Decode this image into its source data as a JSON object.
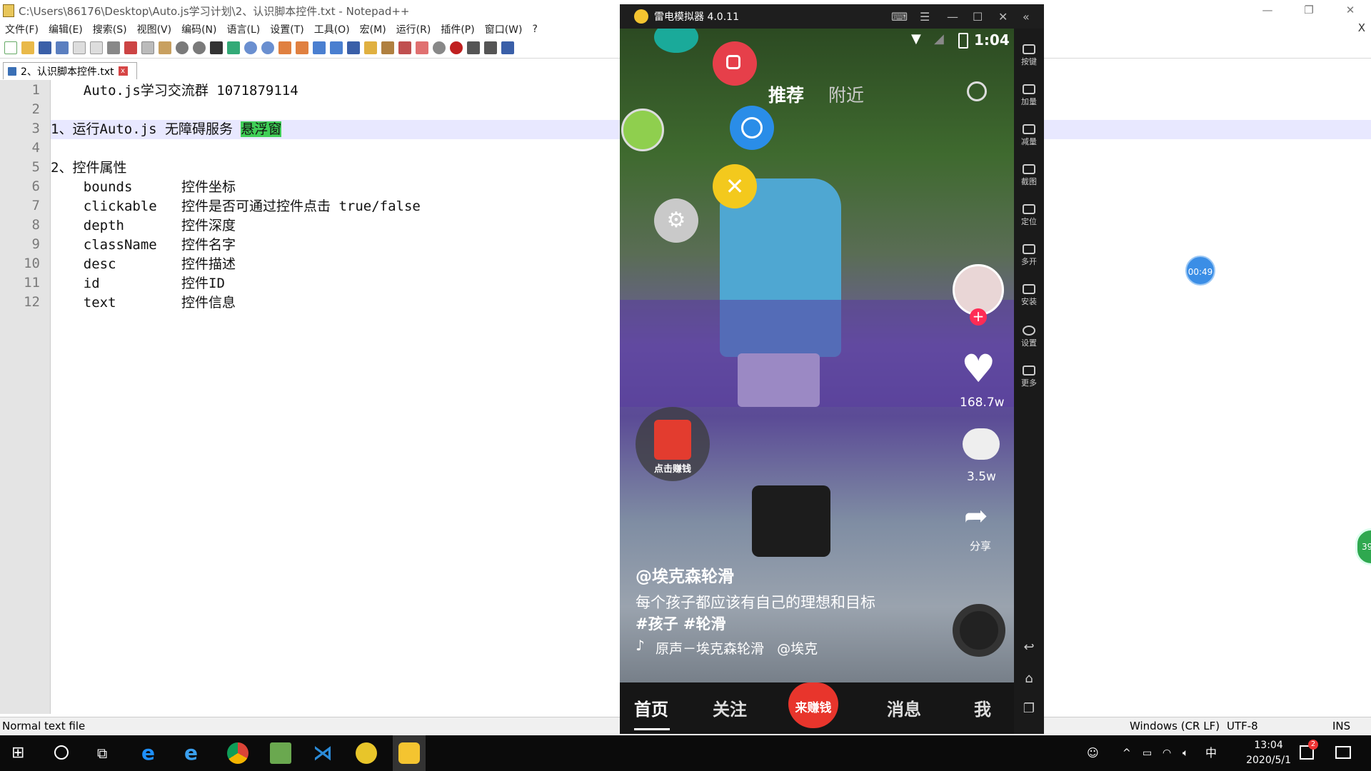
{
  "npp": {
    "title": "C:\\Users\\86176\\Desktop\\Auto.js学习计划\\2、认识脚本控件.txt - Notepad++",
    "menu": [
      "文件(F)",
      "编辑(E)",
      "搜索(S)",
      "视图(V)",
      "编码(N)",
      "语言(L)",
      "设置(T)",
      "工具(O)",
      "宏(M)",
      "运行(R)",
      "插件(P)",
      "窗口(W)",
      "?"
    ],
    "menu_close": "X",
    "tab_label": "2、认识脚本控件.txt",
    "tab_close": "x",
    "line_numbers": [
      "1",
      "2",
      "3",
      "4",
      "5",
      "6",
      "7",
      "8",
      "9",
      "10",
      "11",
      "12"
    ],
    "lines": {
      "l1": "    Auto.js学习交流群 1071879114",
      "l3a": "1、运行Auto.js 无障碍服务 ",
      "l3b": "悬浮窗",
      "l5": "2、控件属性",
      "l6": "    bounds      控件坐标",
      "l7": "    clickable   控件是否可通过控件点击 true/false",
      "l8": "    depth       控件深度",
      "l9": "    className   控件名字",
      "l10": "    desc        控件描述",
      "l11": "    id          控件ID",
      "l12": "    text        控件信息"
    },
    "status": {
      "file_type": "Normal text file",
      "eol": "Windows (CR LF)",
      "encoding": "UTF-8",
      "mode": "INS"
    }
  },
  "emulator": {
    "title": "雷电模拟器 4.0.11",
    "status_time": "1:04",
    "top_tabs": {
      "recommend": "推荐",
      "nearby": "附近"
    },
    "likes": "168.7w",
    "comments": "3.5w",
    "share": "分享",
    "earn_badge": "点击赚钱",
    "author": "@埃克森轮滑",
    "caption": "每个孩子都应该有自己的理想和目标",
    "tags": "#孩子 #轮滑",
    "music": "原声－埃克森轮滑   @埃克",
    "bottom_nav": {
      "home": "首页",
      "follow": "关注",
      "earn": "来赚钱",
      "messages": "消息",
      "me": "我"
    },
    "side_tools": [
      "按键",
      "加量",
      "减量",
      "截图",
      "定位",
      "多开",
      "安装",
      "设置",
      "更多"
    ]
  },
  "desktop": {
    "timer_badge": "00:49",
    "edge_badge": "39"
  },
  "taskbar": {
    "time": "13:04",
    "date": "2020/5/1",
    "ime": "中",
    "notif_count": "2"
  }
}
